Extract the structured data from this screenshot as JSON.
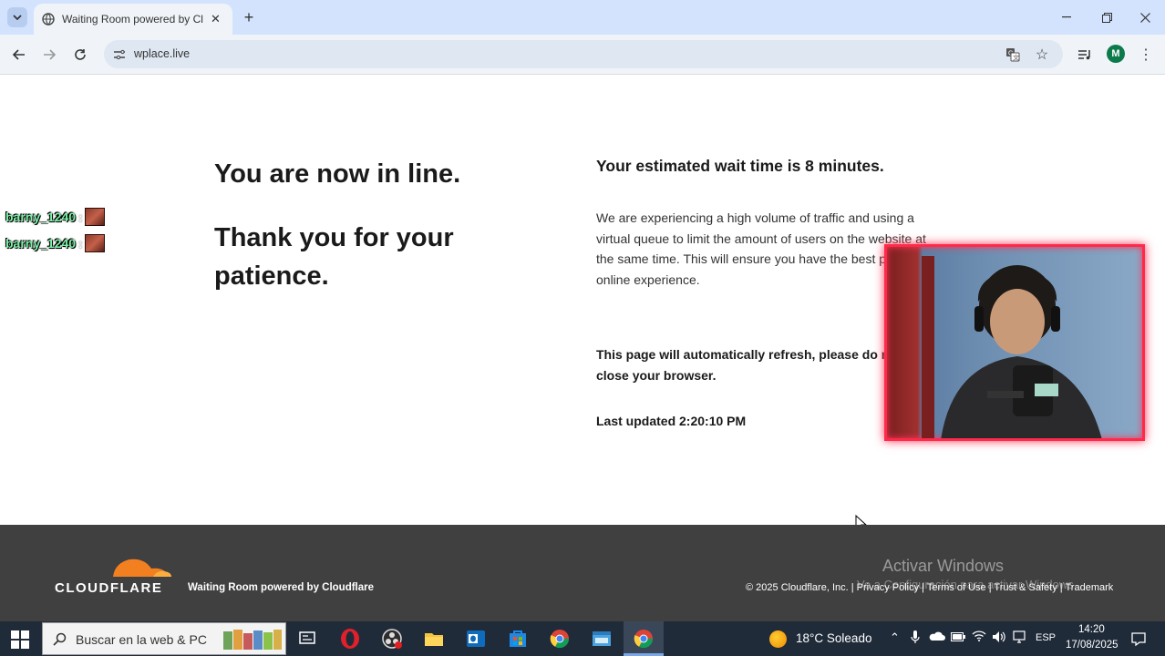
{
  "browser": {
    "tab_title": "Waiting Room powered by Clou",
    "url": "wplace.live",
    "profile_initial": "M"
  },
  "page": {
    "heading_line1": "You are now in line.",
    "heading_line2": "Thank you for your patience.",
    "wait_title": "Your estimated wait time is 8 minutes.",
    "description": "We are experiencing a high volume of traffic and using a virtual queue to limit the amount of users on the website at the same time. This will ensure you have the best possible online experience.",
    "refresh_notice": "This page will automatically refresh, please do not close your browser.",
    "last_updated": "Last updated 2:20:10 PM"
  },
  "chat_overlay": {
    "messages": [
      {
        "user": "barny_1240",
        "sep": ":"
      },
      {
        "user": "barny_1240",
        "sep": ":"
      }
    ]
  },
  "footer": {
    "logo_text": "CLOUDFLARE",
    "powered_by": "Waiting Room powered by Cloudflare",
    "copyright": "© 2025 Cloudflare, Inc. | Privacy Policy | Terms of Use | Trust & Safety | Trademark",
    "activate_title": "Activar Windows",
    "activate_sub": "Ve a Configuración para activar Windows."
  },
  "taskbar": {
    "search_placeholder": "Buscar en la web & PC",
    "weather": "18°C  Soleado",
    "language": "ESP",
    "time": "14:20",
    "date": "17/08/2025"
  },
  "colors": {
    "tabbar": "#d3e3fd",
    "footer": "#404041",
    "cloudflare_orange": "#f38020",
    "chat_name": "#7df0a8",
    "webcam_border": "#ff2a4a"
  }
}
